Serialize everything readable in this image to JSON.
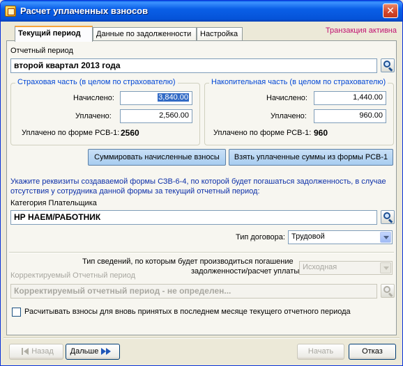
{
  "window": {
    "title": "Расчет уплаченных взносов",
    "close_glyph": "✕",
    "icon": "form-icon",
    "accent_color": "#0831d9",
    "hint_color": "#0c2fa8",
    "status_color": "#c01070"
  },
  "tabs": [
    {
      "label": "Текущий период",
      "active": true
    },
    {
      "label": "Данные по задолженности",
      "active": false
    },
    {
      "label": "Настройка",
      "active": false
    }
  ],
  "transaction_status": "Транзакция активна",
  "period": {
    "label": "Отчетный период",
    "value": "второй квартал 2013 года"
  },
  "insurance": {
    "title": "Страховая часть (в целом по страхователю)",
    "charged_label": "Начислено:",
    "charged_value": "3,840.00",
    "paid_label": "Уплачено:",
    "paid_value": "2,560.00",
    "rsv_label": "Уплачено по форме РСВ-1:",
    "rsv_value": "2560"
  },
  "funded": {
    "title": "Накопительная часть (в целом по страхователю)",
    "charged_label": "Начислено:",
    "charged_value": "1,440.00",
    "paid_label": "Уплачено:",
    "paid_value": "960.00",
    "rsv_label": "Уплачено по форме РСВ-1:",
    "rsv_value": "960"
  },
  "buttons": {
    "sum_charged": "Суммировать начисленные взносы",
    "take_paid": "Взять уплаченные суммы из формы РСВ-1"
  },
  "hint_text": "Укажите реквизиты создаваемой формы СЗВ-6-4, по которой будет погашаться задолженность, в случае отсутствия у сотрудника данной формы за текущий отчетный период:",
  "payer_category": {
    "label": "Категория Плательщика",
    "value": "НР НАЕМ/РАБОТНИК"
  },
  "contract_type": {
    "label": "Тип договора:",
    "value": "Трудовой"
  },
  "info_type": {
    "label_line1": "Тип сведений, по которым будет производиться погашение",
    "label_line2": "задолженности/расчет уплаты:",
    "value": "Исходная"
  },
  "corrected_period": {
    "label": "Корректируемый Отчетный период",
    "value": "Корректируемый отчетный период - не определен..."
  },
  "checkbox": {
    "label": "Расчитывать взносы для вновь принятых в последнем месяце текущего отчетного периода",
    "checked": false
  },
  "footer": {
    "back": "Назад",
    "next": "Дальше",
    "start": "Начать",
    "cancel": "Отказ"
  }
}
